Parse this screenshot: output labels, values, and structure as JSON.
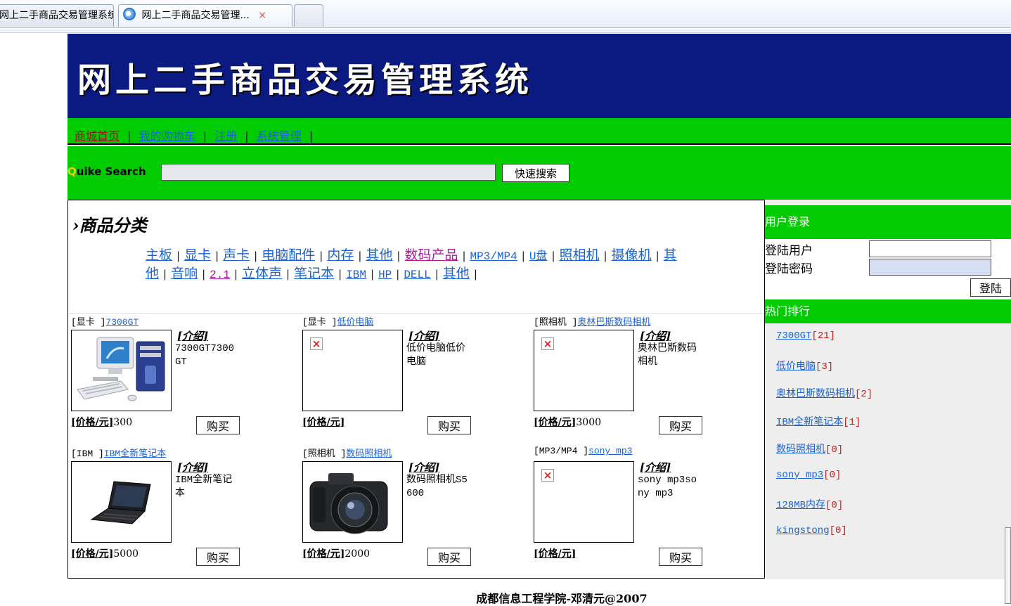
{
  "browser": {
    "tabs": [
      {
        "label": "网上二手商品交易管理系统"
      },
      {
        "label": "网上二手商品交易管理...",
        "close": "×"
      },
      {
        "label": ""
      }
    ]
  },
  "header": {
    "title": "网上二手商品交易管理系统"
  },
  "nav": {
    "items": [
      "商城首页",
      "我的购物车",
      "注册",
      "系统管理"
    ],
    "separator": "|"
  },
  "search": {
    "label_q": "Q",
    "label_rest": "uike Search",
    "value": "",
    "button": "快速搜索"
  },
  "categories": {
    "title": "›商品分类",
    "items": [
      "主板",
      "显卡",
      "声卡",
      "电脑配件",
      "内存",
      "其他",
      "数码产品",
      "MP3/MP4",
      "U盘",
      "照相机",
      "摄像机",
      "其他",
      "音响",
      "2.1",
      "立体声",
      "笔记本",
      "IBM",
      "HP",
      "DELL",
      "其他"
    ]
  },
  "product_labels": {
    "intro": "[介绍]",
    "price": "[价格/元]",
    "buy": "购买"
  },
  "products": [
    {
      "category": "[显卡 ]",
      "name": "7300GT",
      "intro": "7300GT7300GT",
      "price": "300"
    },
    {
      "category": "[显卡 ]",
      "name": "低价电脑",
      "intro": "低价电脑低价电脑",
      "price": ""
    },
    {
      "category": "[照相机 ]",
      "name": "奥林巴斯数码相机",
      "intro": "奥林巴斯数码相机",
      "price": "3000"
    },
    {
      "category": "[IBM ]",
      "name": "IBM全新笔记本",
      "intro": "IBM全新笔记本",
      "price": "5000"
    },
    {
      "category": "[照相机 ]",
      "name": "数码照相机",
      "intro": "数码照相机S5600",
      "price": "2000"
    },
    {
      "category": "[MP3/MP4 ]",
      "name": "sony mp3",
      "intro": "sony mp3sony mp3",
      "price": ""
    }
  ],
  "login": {
    "header": "用户登录",
    "username_label": "登陆用户",
    "password_label": "登陆密码",
    "button": "登陆"
  },
  "hot": {
    "header": "热门排行",
    "items": [
      {
        "name": "7300GT",
        "count": "[21]"
      },
      {
        "name": "低价电脑",
        "count": "[3]"
      },
      {
        "name": "奥林巴斯数码相机",
        "count": "[2]"
      },
      {
        "name": "IBM全新笔记本",
        "count": "[1]"
      },
      {
        "name": "数码照相机",
        "count": "[0]"
      },
      {
        "name": "sony mp3",
        "count": "[0]"
      },
      {
        "name": "128MB内存",
        "count": "[0]"
      },
      {
        "name": "kingstong",
        "count": "[0]"
      }
    ]
  },
  "footer": {
    "text": "成都信息工程学院-邓清元@2007"
  },
  "colors": {
    "banner": "#0a1a80",
    "green": "#00cc00",
    "link": "#1a62d6",
    "count": "#c0201a"
  }
}
